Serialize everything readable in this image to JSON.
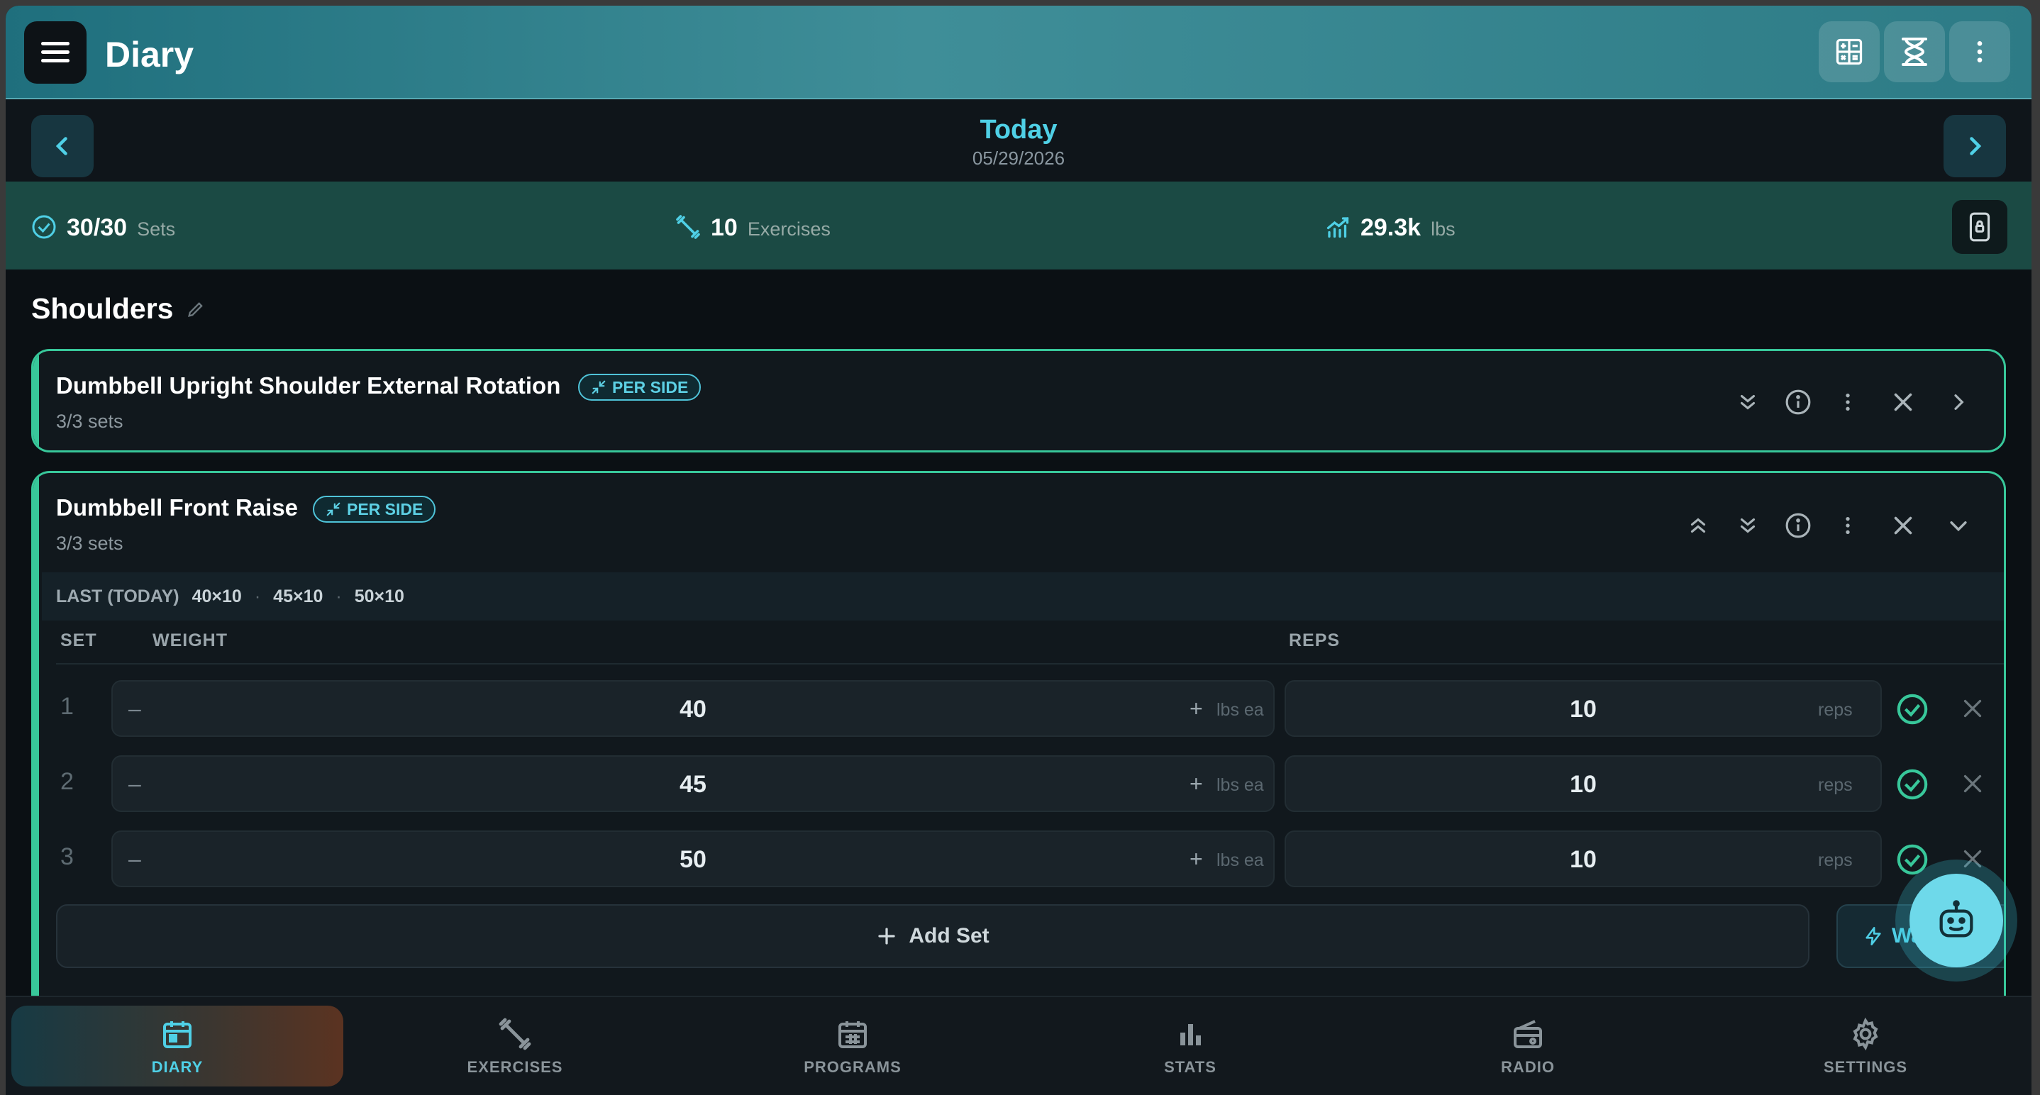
{
  "header": {
    "title": "Diary",
    "icons": [
      "calculator-icon",
      "hourglass-icon",
      "more-vertical-icon"
    ]
  },
  "date_nav": {
    "title": "Today",
    "date": "05/29/2026"
  },
  "summary": {
    "sets_value": "30/30",
    "sets_label": "Sets",
    "exercises_value": "10",
    "exercises_label": "Exercises",
    "volume_value": "29.3k",
    "volume_label": "lbs"
  },
  "section": {
    "title": "Shoulders"
  },
  "exercises": [
    {
      "name": "Dumbbell Upright Shoulder External Rotation",
      "badge": "PER SIDE",
      "sets": "3/3 sets"
    },
    {
      "name": "Dumbbell Front Raise",
      "badge": "PER SIDE",
      "sets": "3/3 sets",
      "last_label": "LAST (TODAY)",
      "last_values": [
        "40×10",
        "45×10",
        "50×10"
      ],
      "last_sep": "·",
      "headers": {
        "set": "SET",
        "weight": "WEIGHT",
        "reps": "REPS"
      },
      "rows": [
        {
          "set": "1",
          "weight": "40",
          "weight_unit": "lbs ea",
          "reps": "10",
          "reps_unit": "reps",
          "done": true
        },
        {
          "set": "2",
          "weight": "45",
          "weight_unit": "lbs ea",
          "reps": "10",
          "reps_unit": "reps",
          "done": true
        },
        {
          "set": "3",
          "weight": "50",
          "weight_unit": "lbs ea",
          "reps": "10",
          "reps_unit": "reps",
          "done": true
        }
      ],
      "add_set_label": "Add Set",
      "warmup_label": "Warm"
    }
  ],
  "bottom_nav": [
    {
      "label": "DIARY",
      "icon": "calendar-icon",
      "active": true
    },
    {
      "label": "EXERCISES",
      "icon": "dumbbell-icon",
      "active": false
    },
    {
      "label": "PROGRAMS",
      "icon": "calendar-grid-icon",
      "active": false
    },
    {
      "label": "STATS",
      "icon": "bar-chart-icon",
      "active": false
    },
    {
      "label": "RADIO",
      "icon": "radio-icon",
      "active": false
    },
    {
      "label": "SETTINGS",
      "icon": "gear-icon",
      "active": false
    }
  ],
  "colors": {
    "accent": "#4fd0e6",
    "success": "#38c79a",
    "background": "#0b1014"
  }
}
